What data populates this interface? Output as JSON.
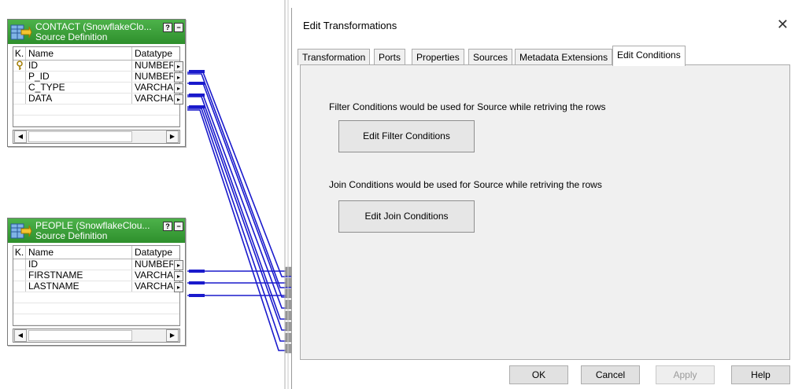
{
  "contact": {
    "title": "CONTACT (SnowflakeClo...",
    "subtitle": "Source Definition",
    "help_button": "?",
    "minimize_button": "−",
    "columns": {
      "key": "K.",
      "name": "Name",
      "datatype": "Datatype"
    },
    "rows": [
      {
        "key": "key-icon",
        "name": "ID",
        "datatype": "NUMBER",
        "arrow": "▸"
      },
      {
        "key": "",
        "name": "P_ID",
        "datatype": "NUMBER",
        "arrow": "▸"
      },
      {
        "key": "",
        "name": "C_TYPE",
        "datatype": "VARCHA",
        "arrow": "▸"
      },
      {
        "key": "",
        "name": "DATA",
        "datatype": "VARCHA",
        "arrow": "▸"
      }
    ],
    "scroll_left": "◀",
    "scroll_right": "▶"
  },
  "people": {
    "title": "PEOPLE (SnowflakeClou...",
    "subtitle": "Source Definition",
    "help_button": "?",
    "minimize_button": "−",
    "columns": {
      "key": "K.",
      "name": "Name",
      "datatype": "Datatype"
    },
    "rows": [
      {
        "key": "",
        "name": "ID",
        "datatype": "NUMBER",
        "arrow": "▸"
      },
      {
        "key": "",
        "name": "FIRSTNAME",
        "datatype": "VARCHA",
        "arrow": "▸"
      },
      {
        "key": "",
        "name": "LASTNAME",
        "datatype": "VARCHA",
        "arrow": "▸"
      }
    ],
    "scroll_left": "◀",
    "scroll_right": "▶"
  },
  "dialog": {
    "title": "Edit Transformations",
    "close": "✕",
    "tabs": [
      {
        "label": "Transformation"
      },
      {
        "label": "Ports"
      },
      {
        "label": "Properties"
      },
      {
        "label": "Sources"
      },
      {
        "label": "Metadata Extensions"
      },
      {
        "label": "Edit Conditions",
        "active": true
      }
    ],
    "filter_text": "Filter Conditions would be used for Source while retriving the rows",
    "filter_button": "Edit Filter Conditions",
    "join_text": "Join Conditions would be used for Source while retriving the rows",
    "join_button": "Edit Join Conditions",
    "buttons": {
      "ok": "OK",
      "cancel": "Cancel",
      "apply": "Apply",
      "help": "Help"
    }
  },
  "colors": {
    "header_green": "#3aa037",
    "link_blue": "#1a1acc",
    "panel_bg": "#f0f0f0"
  }
}
